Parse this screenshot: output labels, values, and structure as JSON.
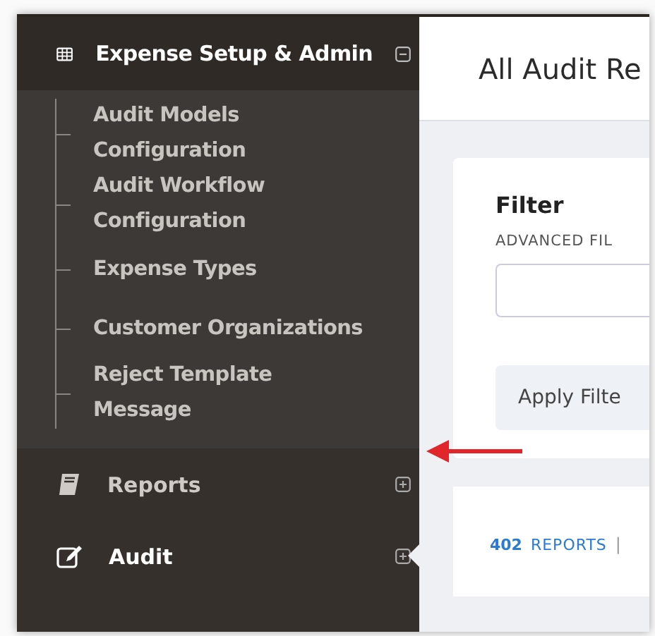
{
  "sidebar": {
    "section": {
      "title": "Expense Setup & Admin",
      "expanded": true,
      "items": [
        {
          "label": "Audit Models Configuration"
        },
        {
          "label": "Audit Workflow Configuration"
        },
        {
          "label": "Expense Types"
        },
        {
          "label": "Customer Organizations"
        },
        {
          "label": "Reject Template Message"
        }
      ]
    },
    "items": [
      {
        "label": "Reports",
        "kind": "reports",
        "selected": false,
        "expanded": false
      },
      {
        "label": "Audit",
        "kind": "audit",
        "selected": true,
        "expanded": false
      }
    ]
  },
  "main": {
    "title": "All Audit Re",
    "filter": {
      "title": "Filter",
      "label": "ADVANCED FIL",
      "apply": "Apply Filte"
    },
    "summary": {
      "count": "402",
      "label": "REPORTS",
      "separator": "|"
    }
  }
}
